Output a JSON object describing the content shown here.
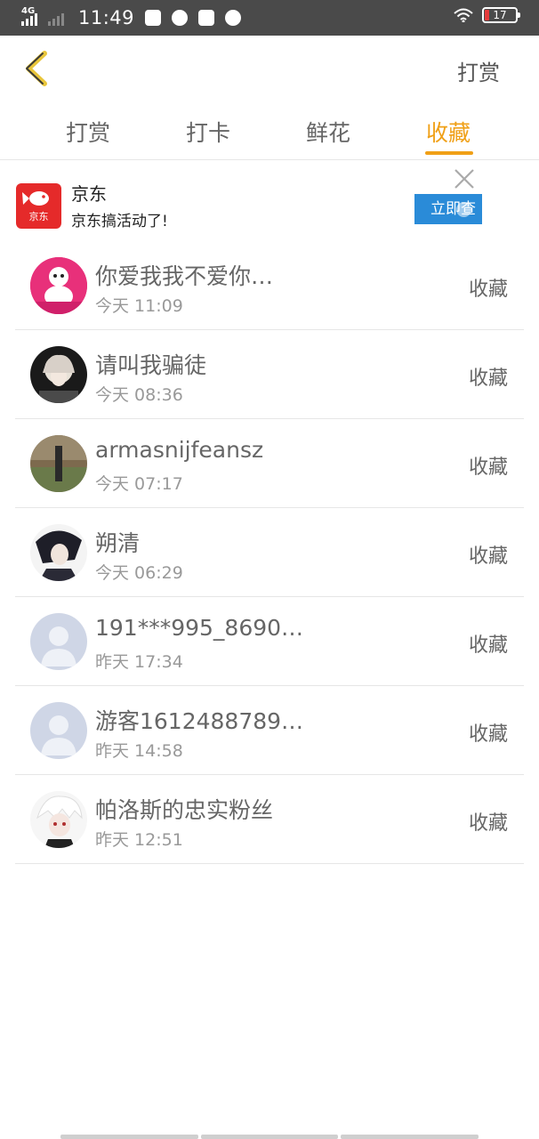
{
  "status_bar": {
    "network": "4G",
    "time": "11:49",
    "battery": "17"
  },
  "header": {
    "back_icon": "chevron-left-icon",
    "action_label": "打赏"
  },
  "tabs": [
    {
      "label": "打赏",
      "active": false
    },
    {
      "label": "打卡",
      "active": false
    },
    {
      "label": "鲜花",
      "active": false
    },
    {
      "label": "收藏",
      "active": true
    }
  ],
  "ad": {
    "title": "京东",
    "subtitle": "京东搞活动了!",
    "logo_text": "京东",
    "button_label": "立即查"
  },
  "list": [
    {
      "name": "你爱我我不爱你…",
      "time": "今天 11:09",
      "status": "收藏",
      "avatar": "pink-character-avatar"
    },
    {
      "name": "请叫我骗徒",
      "time": "今天 08:36",
      "status": "收藏",
      "avatar": "anime-avatar"
    },
    {
      "name": "armasnijfeansz",
      "time": "今天 07:17",
      "status": "收藏",
      "avatar": "photo-avatar"
    },
    {
      "name": "朔清",
      "time": "今天 06:29",
      "status": "收藏",
      "avatar": "anime-avatar-dark"
    },
    {
      "name": "191***995_8690…",
      "time": "昨天 17:34",
      "status": "收藏",
      "avatar": "default-avatar"
    },
    {
      "name": "游客1612488789…",
      "time": "昨天 14:58",
      "status": "收藏",
      "avatar": "default-avatar"
    },
    {
      "name": "帕洛斯的忠实粉丝",
      "time": "昨天 12:51",
      "status": "收藏",
      "avatar": "anime-avatar-white"
    }
  ],
  "colors": {
    "accent": "#f0a017",
    "status_bar": "#4a4a4a",
    "ad_button": "#2a8bd8",
    "jd_red": "#e52a2a",
    "default_avatar": "#cfd6e6"
  }
}
